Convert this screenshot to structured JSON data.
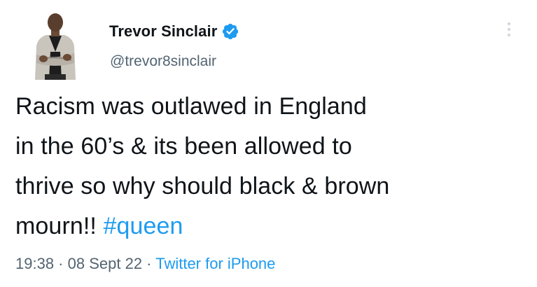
{
  "author": {
    "display_name": "Trevor Sinclair",
    "handle": "@trevor8sinclair",
    "verified": true,
    "avatar_icon": "profile-photo-icon"
  },
  "tweet": {
    "lines": [
      "Racism was outlawed in England",
      "in the 60’s & its been allowed to",
      "thrive so why should black & brown",
      "mourn!! "
    ],
    "hashtag": "#queen"
  },
  "meta": {
    "time": "19:38",
    "separator1": " · ",
    "date": "08 Sept 22",
    "separator2": " · ",
    "source": "Twitter for iPhone"
  },
  "colors": {
    "accent": "#1d9bf0",
    "text": "#0f1419",
    "secondary": "#536471"
  }
}
